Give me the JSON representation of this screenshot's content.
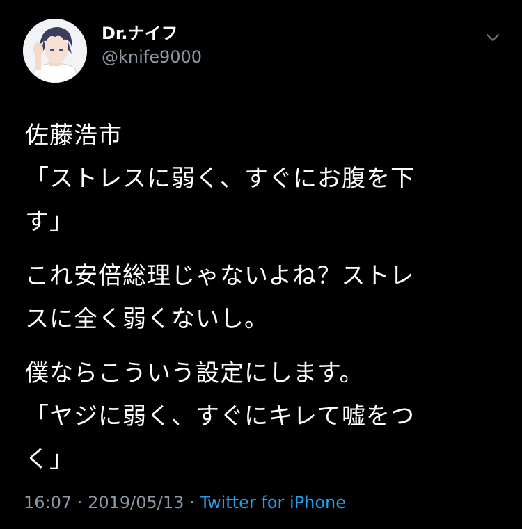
{
  "author": {
    "display_name": "Dr.ナイフ",
    "handle": "@knife9000",
    "avatar_icon": "anime-character-avatar"
  },
  "menu_icon": "chevron-down-icon",
  "tweet": {
    "paragraphs": [
      [
        "佐藤浩市",
        "「ストレスに弱く、すぐにお腹を下",
        "す」"
      ],
      [
        "これ安倍総理じゃないよね？ストレ",
        "スに全く弱くないし。"
      ],
      [
        "僕ならこういう設定にします。",
        "「ヤジに弱く、すぐにキレて嘘をつ",
        "く」"
      ]
    ]
  },
  "meta": {
    "time": "16:07",
    "separator": " · ",
    "date": "2019/05/13",
    "source": "Twitter for iPhone"
  },
  "colors": {
    "background": "#000000",
    "text": "#ffffff",
    "secondary": "#8b98a5",
    "link": "#1da1f2"
  }
}
